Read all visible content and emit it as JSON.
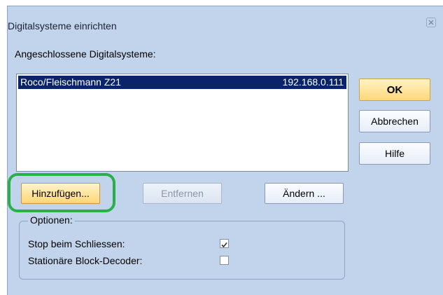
{
  "dialog": {
    "title": "Digitalsysteme einrichten",
    "close_icon": "close-icon"
  },
  "list": {
    "label": "Angeschlossene Digitalsysteme:",
    "items": [
      {
        "name": "Roco/Fleischmann Z21",
        "ip": "192.168.0.111",
        "selected": true
      }
    ]
  },
  "buttons": {
    "ok": "OK",
    "cancel": "Abbrechen",
    "help": "Hilfe",
    "add": "Hinzufügen...",
    "remove": "Entfernen",
    "change": "Ändern ..."
  },
  "options": {
    "legend": "Optionen:",
    "stop_on_close": {
      "label": "Stop beim Schliessen:",
      "checked": true
    },
    "stationary_block_decoder": {
      "label": "Stationäre Block-Decoder:",
      "checked": false
    }
  },
  "colors": {
    "dialog_bg": "#c2d4ec",
    "selection": "#0a246a",
    "highlight": "#29b04a",
    "ok_button": "#ffd87a"
  }
}
